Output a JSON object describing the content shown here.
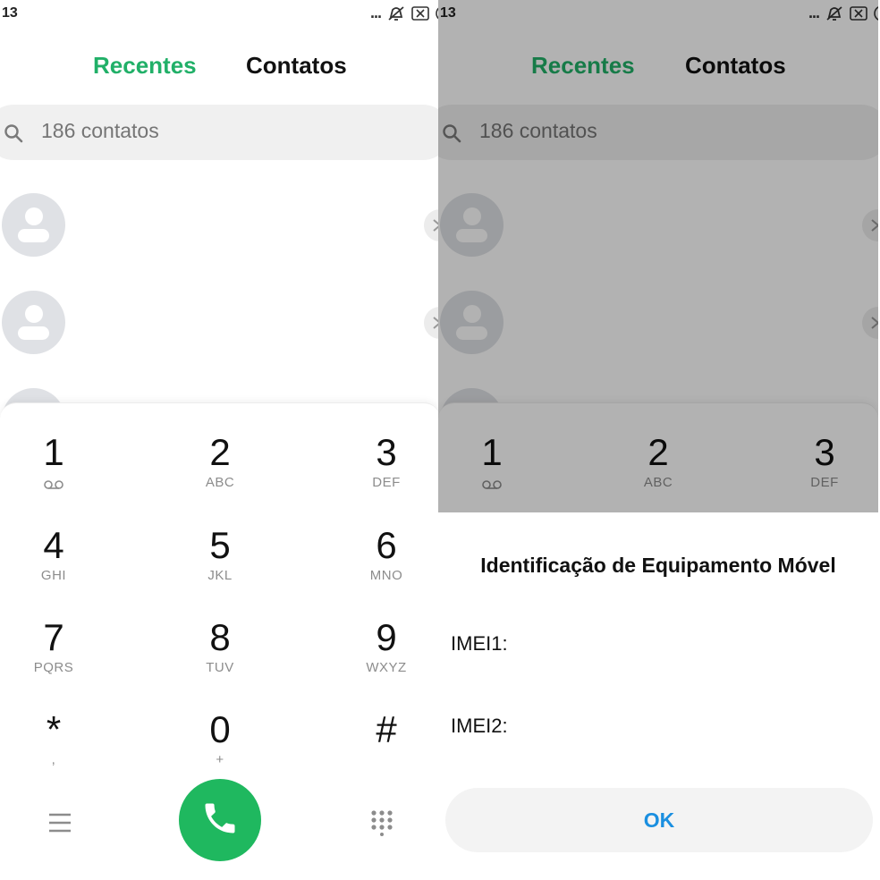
{
  "status_bar": {
    "time": "13",
    "more": "..."
  },
  "tabs": {
    "recents": "Recentes",
    "contacts": "Contatos"
  },
  "search": {
    "placeholder": "186 contatos"
  },
  "keypad": [
    {
      "digit": "1",
      "letters": ""
    },
    {
      "digit": "2",
      "letters": "ABC"
    },
    {
      "digit": "3",
      "letters": "DEF"
    },
    {
      "digit": "4",
      "letters": "GHI"
    },
    {
      "digit": "5",
      "letters": "JKL"
    },
    {
      "digit": "6",
      "letters": "MNO"
    },
    {
      "digit": "7",
      "letters": "PQRS"
    },
    {
      "digit": "8",
      "letters": "TUV"
    },
    {
      "digit": "9",
      "letters": "WXYZ"
    },
    {
      "digit": "*",
      "letters": ","
    },
    {
      "digit": "0",
      "letters": "+"
    },
    {
      "digit": "#",
      "letters": ""
    }
  ],
  "imei_dialog": {
    "title": "Identificação de Equipamento Móvel",
    "imei1_label": "IMEI1:",
    "imei2_label": "IMEI2:",
    "ok_label": "OK"
  },
  "colors": {
    "accent_green": "#21b068",
    "call_green": "#1fb85f",
    "ok_blue": "#1a8fe0"
  }
}
